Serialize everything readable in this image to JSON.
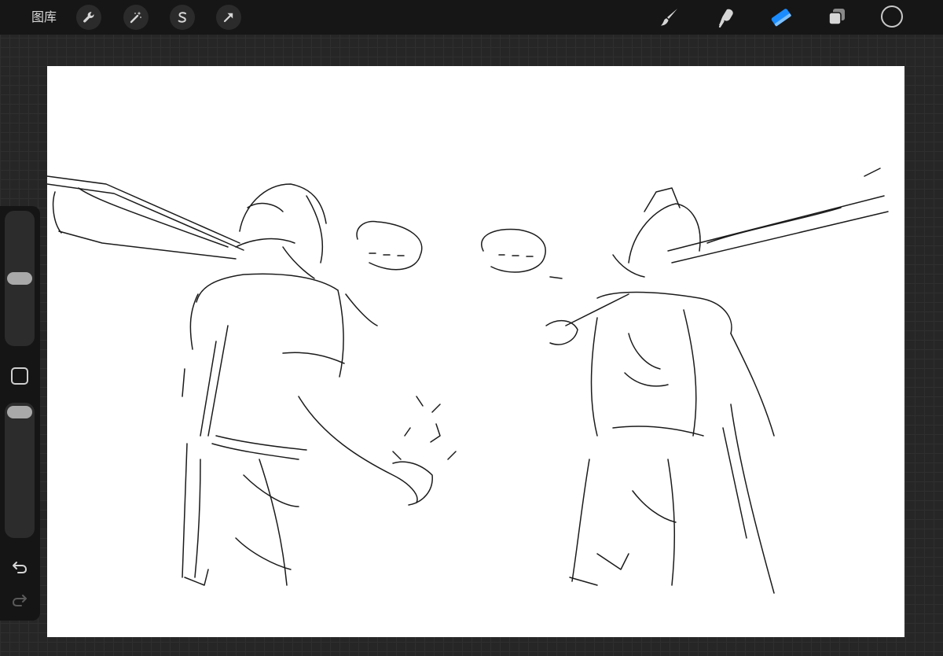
{
  "toolbar": {
    "gallery_label": "图库",
    "actions_icon": "wrench-icon",
    "adjustments_icon": "magic-wand-icon",
    "selection_icon": "selection-s-icon",
    "transform_icon": "arrow-cursor-icon",
    "brush_icon": "brush-icon",
    "smudge_icon": "smudge-icon",
    "eraser_icon": "eraser-icon",
    "layers_icon": "layers-icon",
    "active_tool": "eraser",
    "current_color": "#161616"
  },
  "sidebar": {
    "brush_size_level": 0.5,
    "opacity_level": 0.0,
    "modify_icon": "square-icon",
    "undo_icon": "undo-icon",
    "redo_icon": "redo-icon"
  },
  "colors": {
    "toolbar_bg": "#161616",
    "accent_blue": "#1a8cff",
    "canvas_bg": "#ffffff",
    "workspace_bg": "#262626"
  }
}
